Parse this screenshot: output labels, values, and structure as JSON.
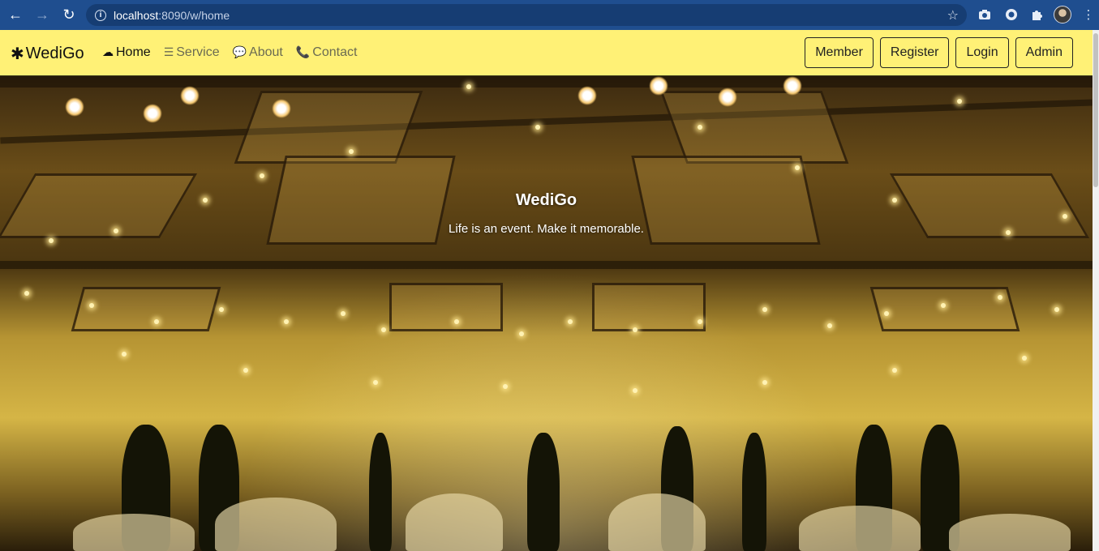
{
  "browser": {
    "url_host": "localhost",
    "url_rest": ":8090/w/home",
    "back_icon": "←",
    "forward_icon": "→",
    "reload_icon": "↻",
    "star_icon": "☆",
    "menu_icon": "⋮"
  },
  "navbar": {
    "brand_icon": "✱",
    "brand": "WediGo",
    "links": [
      {
        "icon": "☁",
        "label": "Home"
      },
      {
        "icon": "☰",
        "label": "Service"
      },
      {
        "icon": "💬",
        "label": "About"
      },
      {
        "icon": "📞",
        "label": "Contact"
      }
    ],
    "buttons": [
      "Member",
      "Register",
      "Login",
      "Admin"
    ],
    "background": "#fff176"
  },
  "hero": {
    "title": "WediGo",
    "subtitle": "Life is an event. Make it memorable."
  }
}
